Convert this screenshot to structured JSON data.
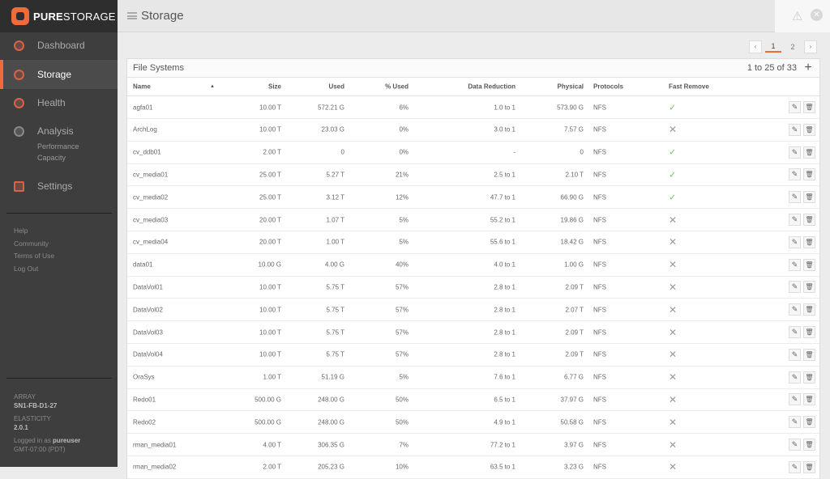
{
  "brand": {
    "bold": "PURE",
    "light": "STORAGE"
  },
  "header": {
    "title": "Storage"
  },
  "sidebar": {
    "items": [
      {
        "label": "Dashboard"
      },
      {
        "label": "Storage"
      },
      {
        "label": "Health"
      },
      {
        "label": "Analysis"
      },
      {
        "label": "Settings"
      }
    ],
    "analysis_sub": [
      "Performance",
      "Capacity"
    ],
    "links": [
      "Help",
      "Community",
      "Terms of Use",
      "Log Out"
    ],
    "array_label": "ARRAY",
    "array_value": "SN1-FB-D1-27",
    "elasticity_label": "ELASTICITY",
    "elasticity_value": "2.0.1",
    "logged_prefix": "Logged in as ",
    "user": "pureuser",
    "timezone": "GMT-07:00 (PDT)"
  },
  "pager": {
    "prev": "‹",
    "pages": [
      "1",
      "2"
    ],
    "next": "›"
  },
  "panel": {
    "title": "File Systems",
    "count": "1 to 25 of 33",
    "add": "+"
  },
  "columns": [
    "Name",
    "Size",
    "Used",
    "% Used",
    "Data Reduction",
    "Physical",
    "Protocols",
    "Fast Remove"
  ],
  "rows": [
    [
      "agfa01",
      "10.00 T",
      "572.21 G",
      "6%",
      "1.0 to 1",
      "573.90 G",
      "NFS",
      true
    ],
    [
      "ArchLog",
      "10.00 T",
      "23.03 G",
      "0%",
      "3.0 to 1",
      "7.57 G",
      "NFS",
      false
    ],
    [
      "cv_ddb01",
      "2.00 T",
      "0",
      "0%",
      "-",
      "0",
      "NFS",
      true
    ],
    [
      "cv_media01",
      "25.00 T",
      "5.27 T",
      "21%",
      "2.5 to 1",
      "2.10 T",
      "NFS",
      true
    ],
    [
      "cv_media02",
      "25.00 T",
      "3.12 T",
      "12%",
      "47.7 to 1",
      "66.90 G",
      "NFS",
      true
    ],
    [
      "cv_media03",
      "20.00 T",
      "1.07 T",
      "5%",
      "55.2 to 1",
      "19.86 G",
      "NFS",
      false
    ],
    [
      "cv_media04",
      "20.00 T",
      "1.00 T",
      "5%",
      "55.6 to 1",
      "18.42 G",
      "NFS",
      false
    ],
    [
      "data01",
      "10.00 G",
      "4.00 G",
      "40%",
      "4.0 to 1",
      "1.00 G",
      "NFS",
      false
    ],
    [
      "DataVol01",
      "10.00 T",
      "5.75 T",
      "57%",
      "2.8 to 1",
      "2.09 T",
      "NFS",
      false
    ],
    [
      "DataVol02",
      "10.00 T",
      "5.75 T",
      "57%",
      "2.8 to 1",
      "2.07 T",
      "NFS",
      false
    ],
    [
      "DataVol03",
      "10.00 T",
      "5.75 T",
      "57%",
      "2.8 to 1",
      "2.09 T",
      "NFS",
      false
    ],
    [
      "DataVol04",
      "10.00 T",
      "5.75 T",
      "57%",
      "2.8 to 1",
      "2.09 T",
      "NFS",
      false
    ],
    [
      "OraSys",
      "1.00 T",
      "51.19 G",
      "5%",
      "7.6 to 1",
      "6.77 G",
      "NFS",
      false
    ],
    [
      "Redo01",
      "500.00 G",
      "248.00 G",
      "50%",
      "6.5 to 1",
      "37.97 G",
      "NFS",
      false
    ],
    [
      "Redo02",
      "500.00 G",
      "248.00 G",
      "50%",
      "4.9 to 1",
      "50.58 G",
      "NFS",
      false
    ],
    [
      "rman_media01",
      "4.00 T",
      "306.35 G",
      "7%",
      "77.2 to 1",
      "3.97 G",
      "NFS",
      false
    ],
    [
      "rman_media02",
      "2.00 T",
      "205.23 G",
      "10%",
      "63.5 to 1",
      "3.23 G",
      "NFS",
      false
    ]
  ],
  "colors": {
    "accent": "#f06b3a",
    "check": "#7bbf6a"
  }
}
